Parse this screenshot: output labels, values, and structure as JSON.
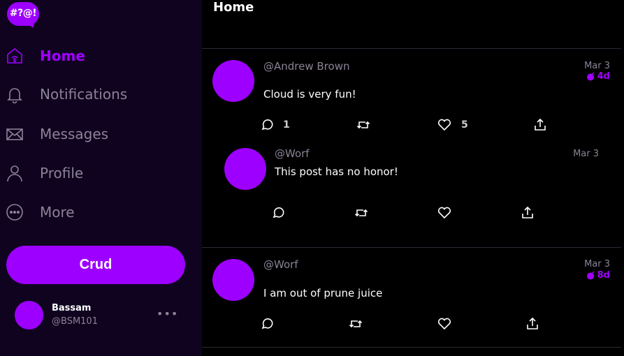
{
  "app": {
    "logo_text": "#?@!"
  },
  "sidebar": {
    "items": [
      {
        "label": "Home",
        "icon": "home-icon",
        "active": true
      },
      {
        "label": "Notifications",
        "icon": "bell-icon"
      },
      {
        "label": "Messages",
        "icon": "envelope-icon"
      },
      {
        "label": "Profile",
        "icon": "person-icon"
      },
      {
        "label": "More",
        "icon": "more-circle-icon"
      }
    ],
    "crud_button": "Crud",
    "profile": {
      "name": "Bassam",
      "handle": "@BSM101",
      "more": "•••"
    }
  },
  "main": {
    "title": "Home",
    "activities": [
      {
        "handle": "@Andrew Brown",
        "message": "Cloud is very fun!",
        "date": "Mar 3",
        "expires": "4d",
        "replies_count": "1",
        "likes_count": "5",
        "replies": [
          {
            "handle": "@Worf",
            "message": "This post has no honor!",
            "date": "Mar 3"
          }
        ]
      },
      {
        "handle": "@Worf",
        "message": "I am out of prune juice",
        "date": "Mar 3",
        "expires": "8d"
      }
    ]
  },
  "colors": {
    "accent": "#9d00ff",
    "sidebar_bg": "#0f0320",
    "muted": "#8b8396"
  }
}
